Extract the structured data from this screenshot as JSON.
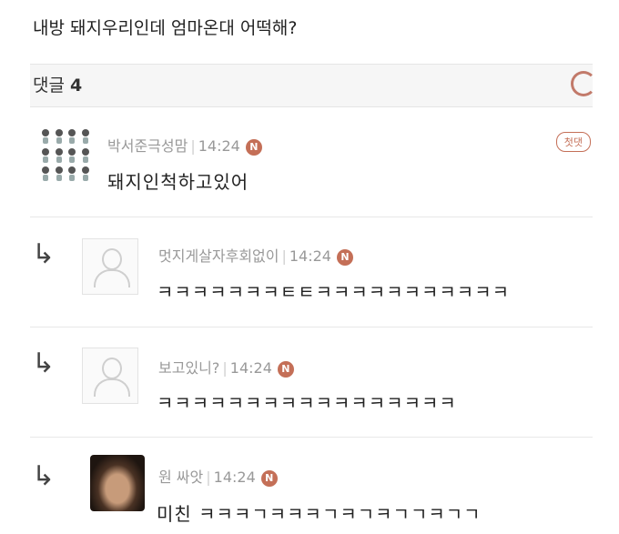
{
  "post": {
    "title": "내방 돼지우리인데 엄마온대 어떡해?"
  },
  "comment_header": {
    "label": "댓글",
    "count": "4"
  },
  "comments": [
    {
      "nickname": "박서준극성맘",
      "time": "14:24",
      "badge": "N",
      "tag": "첫댓",
      "text": "돼지인척하고있어"
    },
    {
      "nickname": "멋지게살자후회없이",
      "time": "14:24",
      "badge": "N",
      "text": "ㅋㅋㅋㅋㅋㅋㅋㅌㅌㅋㅋㅋㅋㅋㅋㅋㅋㅋㅋㅋ",
      "reply_icon": "reply-arrow-icon"
    },
    {
      "nickname": "보고있니?",
      "time": "14:24",
      "badge": "N",
      "text": "ㅋㅋㅋㅋㅋㅋㅋㅋㅋㅋㅋㅋㅋㅋㅋㅋㅋ",
      "reply_icon": "reply-arrow-icon"
    },
    {
      "nickname": "원 싸앗",
      "time": "14:24",
      "badge": "N",
      "text": "미친 ㅋㅋㅋㄱㅋㅋㅋㄱㅋㄱㅋㄱㄱㅋㄱㄱ",
      "reply_icon": "reply-arrow-icon"
    }
  ],
  "colors": {
    "accent": "#c46f57",
    "meta": "#999999",
    "header_bg": "#f6f6f6"
  }
}
